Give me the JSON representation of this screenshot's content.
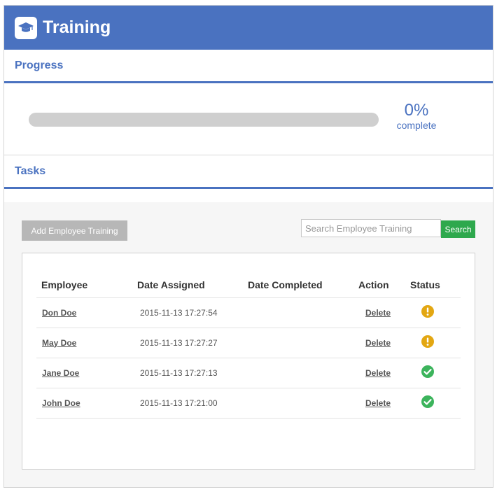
{
  "header": {
    "title": "Training",
    "icon": "graduation-cap-icon",
    "background": "#4a72c0"
  },
  "progress": {
    "section_title": "Progress",
    "percent": 0,
    "percent_text": "0%",
    "label": "complete"
  },
  "tasks": {
    "section_title": "Tasks",
    "add_button": "Add Employee Training",
    "search_placeholder": "Search Employee Training",
    "search_button": "Search",
    "columns": [
      "Employee",
      "Date Assigned",
      "Date Completed",
      "Action",
      "Status"
    ],
    "rows": [
      {
        "employee": "Don Doe",
        "date_assigned": "2015-11-13 17:27:54",
        "date_completed": "",
        "action": "Delete",
        "status": "warning-icon"
      },
      {
        "employee": "May Doe",
        "date_assigned": "2015-11-13 17:27:27",
        "date_completed": "",
        "action": "Delete",
        "status": "warning-icon"
      },
      {
        "employee": "Jane Doe",
        "date_assigned": "2015-11-13 17:27:13",
        "date_completed": "",
        "action": "Delete",
        "status": "check-icon"
      },
      {
        "employee": "John Doe",
        "date_assigned": "2015-11-13 17:21:00",
        "date_completed": "",
        "action": "Delete",
        "status": "check-icon"
      }
    ]
  },
  "colors": {
    "accent": "#4a72c0",
    "search_button": "#2ea84d",
    "add_button": "#b7b7b7",
    "warning": "#e3a712",
    "success": "#3cb45c"
  }
}
